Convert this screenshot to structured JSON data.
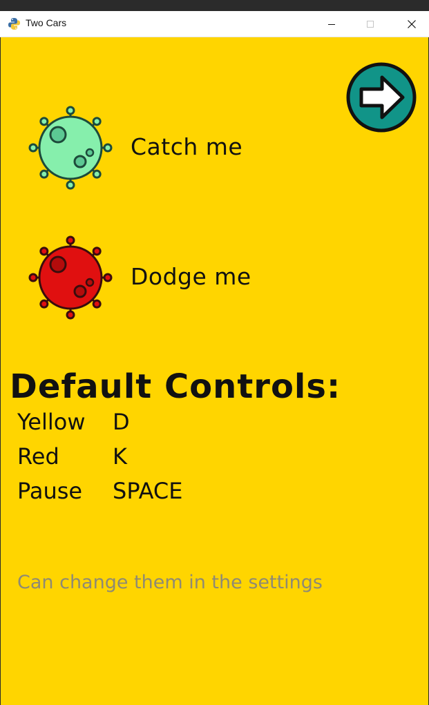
{
  "window": {
    "title": "Two Cars",
    "icon": "python-icon",
    "buttons": [
      "minimize-icon",
      "maximize-icon",
      "close-icon"
    ]
  },
  "game": {
    "background_color": "#FFD500",
    "next_button_icon": "arrow-right-icon",
    "items": [
      {
        "label": "Catch me",
        "icon": "virus-green-icon",
        "color": "#86EFAC"
      },
      {
        "label": "Dodge me",
        "icon": "virus-red-icon",
        "color": "#E01010"
      }
    ],
    "controls_heading": "Default Controls:",
    "controls": [
      {
        "name": "Yellow",
        "key": "D"
      },
      {
        "name": "Red",
        "key": "K"
      },
      {
        "name": "Pause",
        "key": "SPACE"
      }
    ],
    "hint": "Can change them in the settings"
  }
}
